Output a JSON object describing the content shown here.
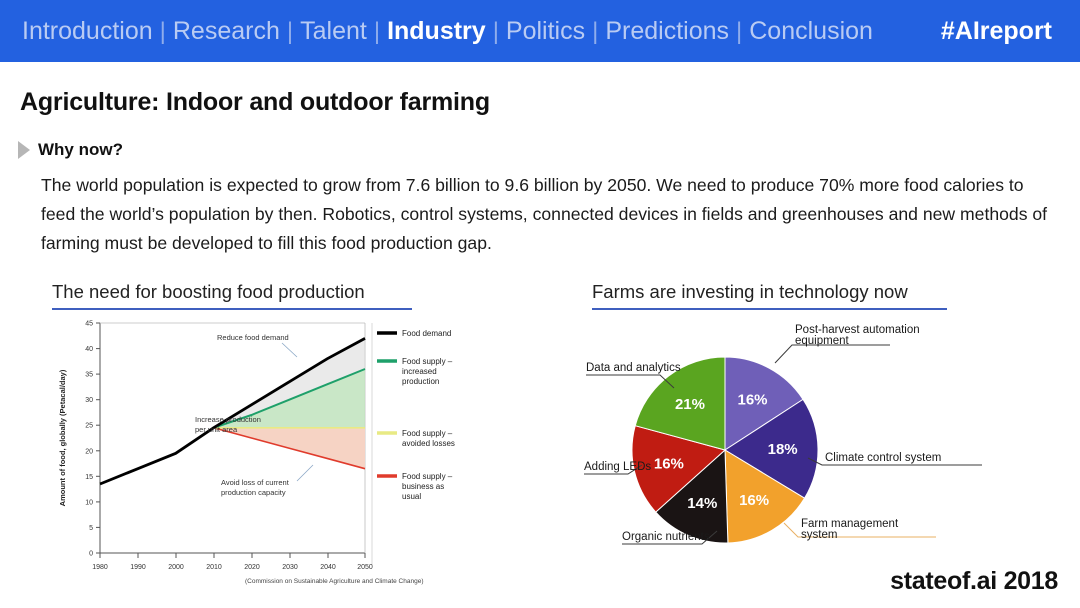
{
  "header": {
    "nav_items": [
      {
        "label": "Introduction",
        "active": false
      },
      {
        "label": "Research",
        "active": false
      },
      {
        "label": "Talent",
        "active": false
      },
      {
        "label": "Industry",
        "active": true
      },
      {
        "label": "Politics",
        "active": false
      },
      {
        "label": "Predictions",
        "active": false
      },
      {
        "label": "Conclusion",
        "active": false
      }
    ],
    "separator": "|",
    "hashtag": "#AIreport",
    "background_color": "#2361e0",
    "active_color": "#ffffff",
    "inactive_color": "#b9cbf3"
  },
  "slide": {
    "title": "Agriculture: Indoor and outdoor farming",
    "bullet_label": "Why now?",
    "paragraph": "The world population is expected to grow from 7.6 billion to 9.6 billion by 2050. We need to produce 70% more food calories to feed the world’s population by then. Robotics, control systems, connected devices in fields and greenhouses and new methods of farming must be developed to fill this food production gap.",
    "brand": "stateof.ai 2018",
    "accent_rule_color": "#3f5fbf"
  },
  "left_panel": {
    "subhead": "The need for boosting food production"
  },
  "right_panel": {
    "subhead": "Farms are investing in technology now"
  },
  "chart_data": [
    {
      "type": "area",
      "title": "The need for boosting food production",
      "xlabel": "",
      "ylabel": "Amount of food, globally (Petacal/day)",
      "xlim": [
        1980,
        2050
      ],
      "ylim": [
        0,
        45
      ],
      "xticks": [
        "1980",
        "1990",
        "2000",
        "2010",
        "2020",
        "2030",
        "2040",
        "2050"
      ],
      "yticks": [
        "0",
        "5",
        "10",
        "15",
        "20",
        "25",
        "30",
        "35",
        "40",
        "45"
      ],
      "grid": false,
      "legend_position": "right",
      "source_note": "(Commission on Sustainable Agriculture and Climate Change)",
      "x": [
        1980,
        1990,
        2000,
        2010,
        2020,
        2030,
        2040,
        2050
      ],
      "series": [
        {
          "name": "Food demand",
          "color": "#000000",
          "values": [
            13.5,
            16.5,
            19.5,
            24.5,
            29.0,
            33.5,
            38.0,
            42.0
          ]
        },
        {
          "name": "Food supply – increased production",
          "color": "#1ea06a",
          "values": [
            13.5,
            16.5,
            19.5,
            24.5,
            27.0,
            30.0,
            33.0,
            36.0
          ]
        },
        {
          "name": "Food supply – avoided losses",
          "color": "#e8ea84",
          "values": [
            13.5,
            16.5,
            19.5,
            24.5,
            24.5,
            24.5,
            24.5,
            24.5
          ]
        },
        {
          "name": "Food supply – business as usual",
          "color": "#e03b2c",
          "values": [
            13.5,
            16.5,
            19.5,
            24.5,
            22.5,
            20.5,
            18.5,
            16.5
          ]
        }
      ],
      "annotations": [
        "Reduce food demand",
        "Increase production per unit area",
        "Avoid loss of current production capacity"
      ]
    },
    {
      "type": "pie",
      "title": "Farms are investing in technology now",
      "legend_position": "callouts",
      "categories": [
        "Post-harvest automation equipment",
        "Climate control system",
        "Farm management system",
        "Organic nutrients",
        "Adding LEDs",
        "Data and analytics"
      ],
      "values": [
        16,
        18,
        16,
        14,
        16,
        21
      ],
      "value_labels": [
        "16%",
        "18%",
        "16%",
        "14%",
        "16%",
        "21%"
      ],
      "colors": [
        "#6f5fb8",
        "#3c2a8c",
        "#f2a12c",
        "#1a1414",
        "#c01c12",
        "#5aa520"
      ]
    }
  ]
}
